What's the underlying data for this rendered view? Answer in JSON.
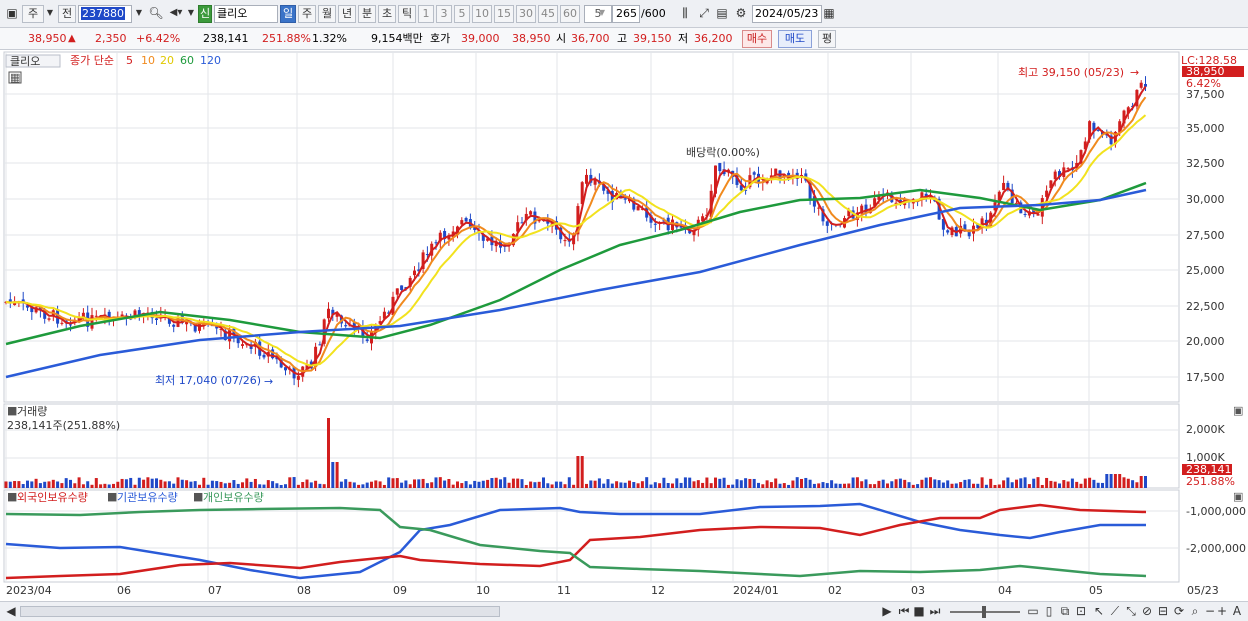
{
  "toolbar": {
    "type_label": "주",
    "prev_label": "전",
    "code_value": "237880",
    "new_badge": "신",
    "name_value": "클리오",
    "periods": [
      "일",
      "주",
      "월",
      "년",
      "분",
      "초",
      "틱"
    ],
    "intervals": [
      "1",
      "3",
      "5",
      "10",
      "15",
      "30",
      "45",
      "60"
    ],
    "interval_value": "5",
    "count_value": "265",
    "count_max": "/600",
    "date_value": "2024/05/23"
  },
  "quote": {
    "price": "38,950",
    "change": "2,350",
    "change_pct": "+6.42%",
    "volume": "238,141",
    "vol_ratio": "251.88%",
    "turnover": "1.32%",
    "amount": "9,154백만",
    "ask_label": "호가",
    "ask1": "39,000",
    "bid1": "38,950",
    "open_label": "시",
    "open": "36,700",
    "high_label": "고",
    "high": "39,150",
    "low_label": "저",
    "low": "36,200",
    "buy_label": "매수",
    "sell_label": "매도",
    "flat_label": "평"
  },
  "price_panel": {
    "stock_name": "클리오",
    "ma_title": "종가 단순",
    "ma_periods": [
      "5",
      "10",
      "20",
      "60",
      "120"
    ],
    "lc_label": "LC:128.58",
    "last_price_tag": "38,950",
    "last_pct_tag": "6.42%",
    "high_annotation": "최고 39,150 (05/23)",
    "low_annotation": "최저 17,040 (07/26)",
    "dividend_annotation": "배당락(0.00%)",
    "y_ticks": [
      "37,500",
      "35,000",
      "32,500",
      "30,000",
      "27,500",
      "25,000",
      "22,500",
      "20,000",
      "17,500"
    ]
  },
  "volume_panel": {
    "title": "거래량",
    "value": "238,141주(251.88%)",
    "y_ticks": [
      "2,000K",
      "1,000K"
    ],
    "last_tag": "238,141",
    "pct_tag": "251.88%"
  },
  "holding_panel": {
    "legend": [
      "외국인보유수량",
      "기관보유수량",
      "개인보유수량"
    ],
    "y_ticks": [
      "-1,000,000",
      "-2,000,000"
    ]
  },
  "x_axis": [
    "2023/04",
    "06",
    "07",
    "08",
    "09",
    "10",
    "11",
    "12",
    "2024/01",
    "02",
    "03",
    "04",
    "05"
  ],
  "last_date": "05/23",
  "colors": {
    "up": "#d21e1e",
    "down": "#1f49c8",
    "ma5": "#d21e1e",
    "ma10": "#f08a1e",
    "ma20": "#f2e21e",
    "ma60": "#1e9a3c",
    "ma120": "#2a5bd8",
    "foreign": "#2a5bd8",
    "institution": "#d21e1e",
    "retail": "#3a9a5c"
  }
}
